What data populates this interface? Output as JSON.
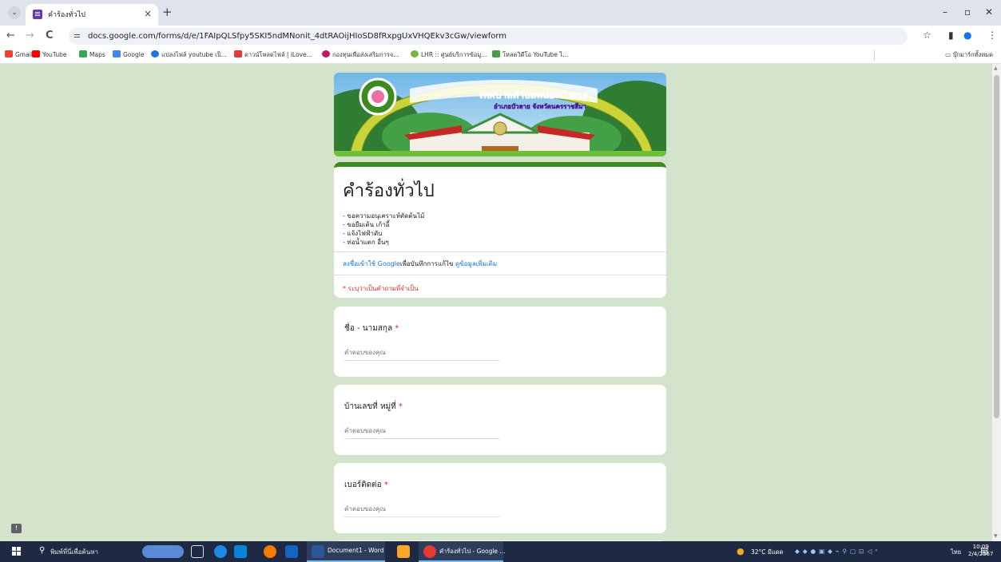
{
  "browser": {
    "tab_title": "คำร้องทั่วไป",
    "tab_close": "×",
    "new_tab": "+",
    "url": "docs.google.com/forms/d/e/1FAIpQLSfpy5SKI5ndMNonit_4dtRAOijHIoSD8fRxpgUxVHQEkv3cGw/viewform",
    "window_controls": {
      "minimize": "–",
      "restore": "▫",
      "close": "✕"
    },
    "nav": {
      "back": "←",
      "forward": "→",
      "reload": "C"
    }
  },
  "bookmarks": {
    "items": [
      {
        "label": "Gmail",
        "icon": "gmail-icon",
        "color": "#ea4335"
      },
      {
        "label": "YouTube",
        "icon": "youtube-icon",
        "color": "#ff0000"
      },
      {
        "label": "Maps",
        "icon": "maps-icon",
        "color": "#34a853"
      },
      {
        "label": "Google",
        "icon": "google-icon",
        "color": "#4285f4"
      },
      {
        "label": "แปลงไฟล์ youtube เป็...",
        "icon": "convert-icon",
        "color": "#1a73e8"
      },
      {
        "label": "ดาวน์โหลดไฟล์ | iLove...",
        "icon": "ilove-icon",
        "color": "#e53935"
      },
      {
        "label": "กองทุนเพื่อส่งเสริมการจ...",
        "icon": "fund-icon",
        "color": "#c2185b"
      },
      {
        "label": "LHR :: ศูนย์บริการข้อมู...",
        "icon": "lhr-icon",
        "color": "#7cb342"
      },
      {
        "label": "โหลดวิดีโอ YouTube ไ...",
        "icon": "video-download-icon",
        "color": "#43a047"
      }
    ],
    "folder": "บุ๊กมาร์กทั้งหมด"
  },
  "form": {
    "banner": {
      "title": "เทศบาลตำบลหนองบัวลาย",
      "subtitle": "อำเภอบัวลาย จังหวัดนครราชสีมา"
    },
    "title": "คำร้องทั่วไป",
    "description": [
      "- ขอความอนุเคราะห์ตัดต้นไม้",
      "- ขอยืมเต้น เก้าอี้",
      "- แจ้งไฟฟ้าดับ",
      "- ท่อน้ำแตก อื่นๆ"
    ],
    "signin": {
      "link": "ลงชื่อเข้าใช้ Google",
      "middle": "เพื่อบันทึกการแก้ไข",
      "more": "ดูข้อมูลเพิ่มเติม"
    },
    "required_note": "* ระบุว่าเป็นคำถามที่จำเป็น",
    "questions": [
      {
        "label": "ชื่อ - นามสกุล",
        "placeholder": "คำตอบของคุณ"
      },
      {
        "label": "บ้านเลขที่ หมู่ที่",
        "placeholder": "คำตอบของคุณ"
      },
      {
        "label": "เบอร์ติดต่อ",
        "placeholder": "คำตอบของคุณ"
      }
    ],
    "required_mark": "*"
  },
  "taskbar": {
    "search_placeholder": "พิมพ์ที่นี่เพื่อค้นหา",
    "apps": [
      {
        "label": "Document1 - Word",
        "icon": "word-icon"
      },
      {
        "label": "คำร้องทั่วไป - Google ...",
        "icon": "chrome-icon"
      }
    ],
    "weather": "32°C มีแดด",
    "language": "ไทย",
    "time": "10:09",
    "date": "2/4/2567"
  },
  "colors": {
    "page_bg": "#d4e3cb",
    "accent": "#3d8b1f",
    "link": "#1a73e8",
    "required": "#d93025"
  }
}
